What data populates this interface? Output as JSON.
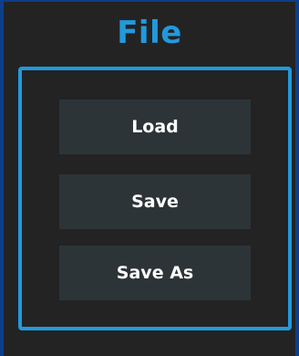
{
  "panel": {
    "title": "File",
    "accent_color": "#2299dd",
    "buttons": [
      {
        "label": "Load"
      },
      {
        "label": "Save"
      },
      {
        "label": "Save As"
      }
    ]
  }
}
